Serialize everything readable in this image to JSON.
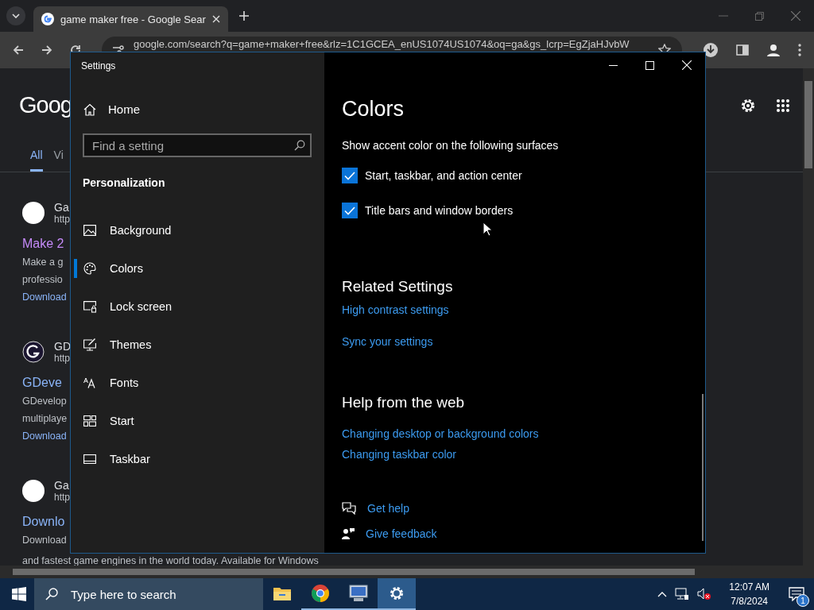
{
  "browser": {
    "tab": {
      "title": "game maker free - Google Sear"
    },
    "address_bar": {
      "url": "google.com/search?q=game+maker+free&rlz=1C1GCEA_enUS1074US1074&oq=ga&gs_lcrp=EgZjaHJvbW"
    },
    "page": {
      "logo": "Goog",
      "tabs": [
        {
          "label": "All",
          "selected": true
        },
        {
          "label": "Vi",
          "selected": false
        }
      ],
      "results": [
        {
          "kind": "blank",
          "site": "Ga",
          "url": "http",
          "title": "Make 2",
          "visited": true,
          "snippet": [
            "Make a g",
            "professio"
          ],
          "link": "Download"
        },
        {
          "kind": "logo",
          "site": "GD",
          "url": "http",
          "title": "GDeve",
          "visited": false,
          "snippet": [
            "GDevelop",
            "multiplaye"
          ],
          "link": "Download"
        },
        {
          "kind": "blank",
          "site": "Ga",
          "url": "http",
          "title": "Downlo",
          "visited": false,
          "snippet": [
            "Download",
            "and fastest game engines in the world today. Available for Windows"
          ]
        }
      ]
    }
  },
  "settings": {
    "window": {
      "title": "Settings"
    },
    "nav": {
      "home": "Home",
      "search": {
        "placeholder": "Find a setting"
      },
      "section": "Personalization",
      "items": [
        {
          "kind": "background",
          "label": "Background",
          "selected": false
        },
        {
          "kind": "colors",
          "label": "Colors",
          "selected": true
        },
        {
          "kind": "lock",
          "label": "Lock screen",
          "selected": false
        },
        {
          "kind": "themes",
          "label": "Themes",
          "selected": false
        },
        {
          "kind": "fonts",
          "label": "Fonts",
          "selected": false
        },
        {
          "kind": "start",
          "label": "Start",
          "selected": false
        },
        {
          "kind": "taskbar",
          "label": "Taskbar",
          "selected": false
        }
      ]
    },
    "content": {
      "heading": "Colors",
      "subheading": "Show accent color on the following surfaces",
      "checkboxes": [
        {
          "label": "Start, taskbar, and action center",
          "checked": true
        },
        {
          "label": "Title bars and window borders",
          "checked": true
        }
      ],
      "related": {
        "heading": "Related Settings",
        "links": [
          "High contrast settings",
          "Sync your settings"
        ]
      },
      "help": {
        "heading": "Help from the web",
        "links": [
          "Changing desktop or background colors",
          "Changing taskbar color"
        ]
      },
      "actions": [
        {
          "kind": "help",
          "label": "Get help"
        },
        {
          "kind": "feedback",
          "label": "Give feedback"
        }
      ]
    }
  },
  "taskbar": {
    "search": {
      "placeholder": "Type here to search"
    },
    "apps": [
      {
        "kind": "explorer",
        "running": false,
        "selected": false
      },
      {
        "kind": "chrome",
        "running": true,
        "selected": false
      },
      {
        "kind": "monitor",
        "running": true,
        "selected": false
      },
      {
        "kind": "settings",
        "running": true,
        "selected": true
      }
    ],
    "clock": {
      "time": "12:07 AM",
      "date": "7/8/2024"
    },
    "notifications": {
      "count": "1"
    }
  }
}
